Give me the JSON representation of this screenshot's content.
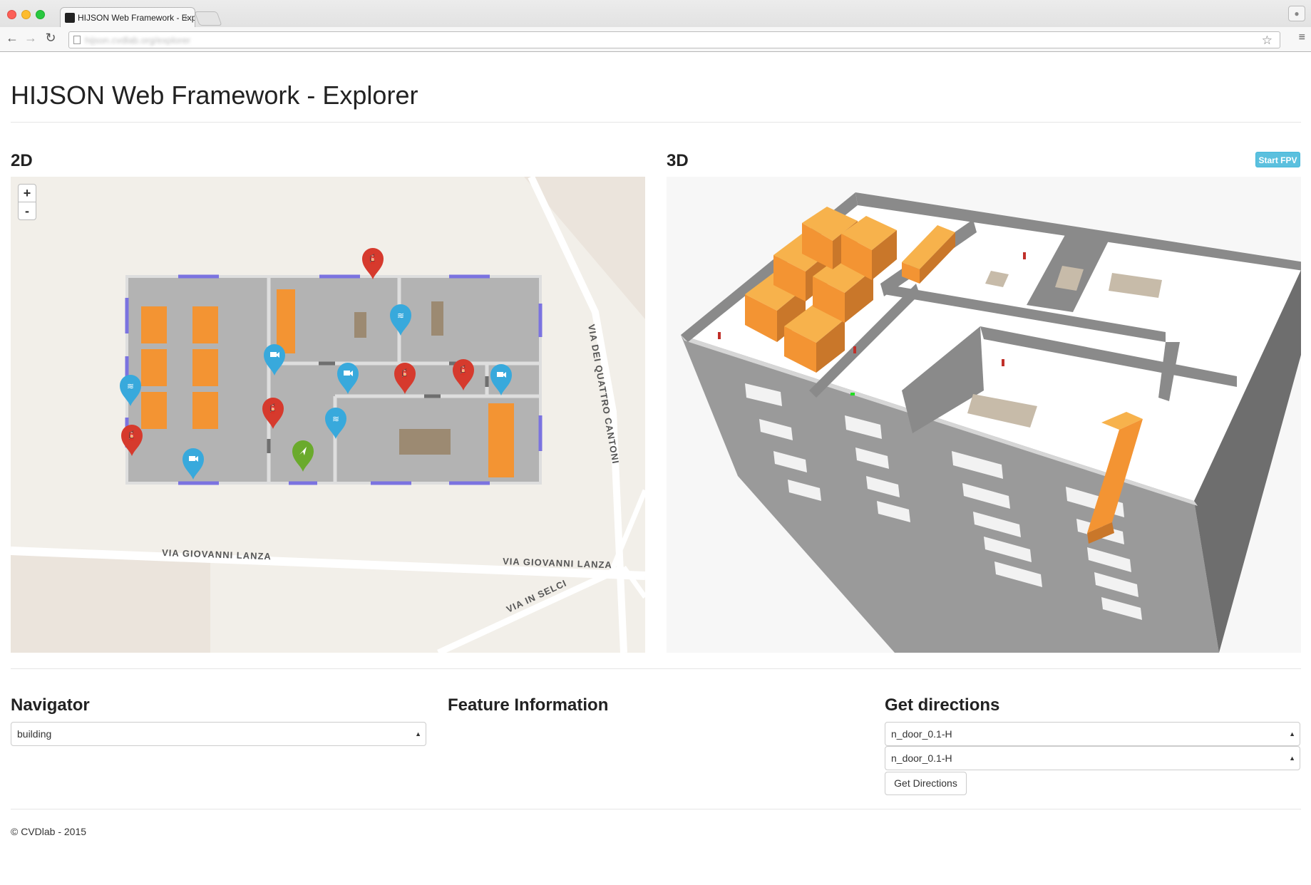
{
  "browser": {
    "tab_title": "HIJSON Web Framework - Explorer",
    "tab_close": "×",
    "url": "hijson.cvdlab.org/explorer",
    "back_icon": "←",
    "forward_icon": "→",
    "reload_icon": "↻",
    "star_icon": "☆",
    "menu_icon": "≡"
  },
  "page": {
    "title": "HIJSON Web Framework - Explorer",
    "section_2d": "2D",
    "section_3d": "3D",
    "start_fpv_label": "Start FPV"
  },
  "map2d": {
    "zoom_in": "+",
    "zoom_out": "-",
    "streets": [
      "VIA GIOVANNI LANZA",
      "VIA GIOVANNI LANZA",
      "VIA DEI QUATTRO CANTONI",
      "VIA IN SELCI"
    ]
  },
  "panels": {
    "navigator": {
      "title": "Navigator",
      "selected": "building"
    },
    "feature_info": {
      "title": "Feature Information"
    },
    "directions": {
      "title": "Get directions",
      "from": "n_door_0.1-H",
      "to": "n_door_0.1-H",
      "button_label": "Get Directions"
    }
  },
  "footer": {
    "text": "© CVDlab - 2015"
  },
  "colors": {
    "fire": "#d63a2d",
    "camera": "#38a9dc",
    "wifi": "#38a9dc",
    "you": "#6aaa2c",
    "furniture": "#f39433",
    "floor": "#b3b3b3",
    "door": "#7b73e0",
    "fpv": "#5bc0de"
  }
}
